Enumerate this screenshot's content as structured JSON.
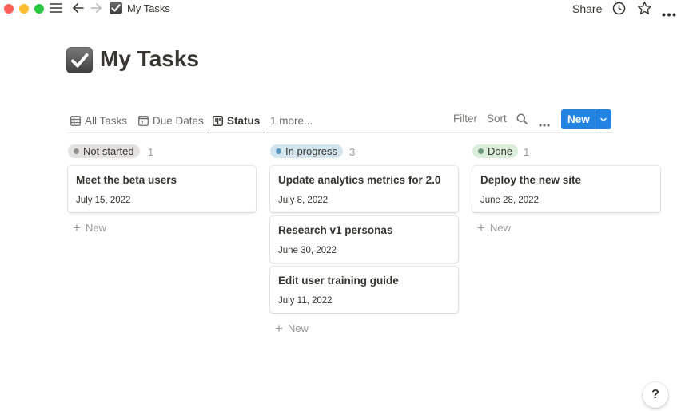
{
  "window": {
    "breadcrumb_title": "My Tasks",
    "share_label": "Share"
  },
  "page": {
    "title": "My Tasks",
    "icon": "checkbox-icon"
  },
  "views": {
    "tabs": [
      {
        "label": "All Tasks",
        "icon": "table-icon"
      },
      {
        "label": "Due Dates",
        "icon": "calendar-icon"
      },
      {
        "label": "Status",
        "icon": "board-icon",
        "active": true
      },
      {
        "label": "1 more..."
      }
    ],
    "filter_label": "Filter",
    "sort_label": "Sort",
    "new_label": "New"
  },
  "board": {
    "columns": [
      {
        "status": "Not started",
        "count": "1",
        "color": "#e3e2e0",
        "dot": "#91918e",
        "cards": [
          {
            "title": "Meet the beta users",
            "date": "July 15, 2022"
          }
        ],
        "new_label": "New"
      },
      {
        "status": "In progress",
        "count": "3",
        "color": "#d3e5ef",
        "dot": "#5b97bd",
        "cards": [
          {
            "title": "Update analytics metrics for 2.0",
            "date": "July 8, 2022"
          },
          {
            "title": "Research v1 personas",
            "date": "June 30, 2022"
          },
          {
            "title": "Edit user training guide",
            "date": "July 11, 2022"
          }
        ],
        "new_label": "New"
      },
      {
        "status": "Done",
        "count": "1",
        "color": "#dbeddb",
        "dot": "#6c9b7d",
        "cards": [
          {
            "title": "Deploy the new site",
            "date": "June 28, 2022"
          }
        ],
        "new_label": "New"
      }
    ]
  },
  "help_label": "?"
}
